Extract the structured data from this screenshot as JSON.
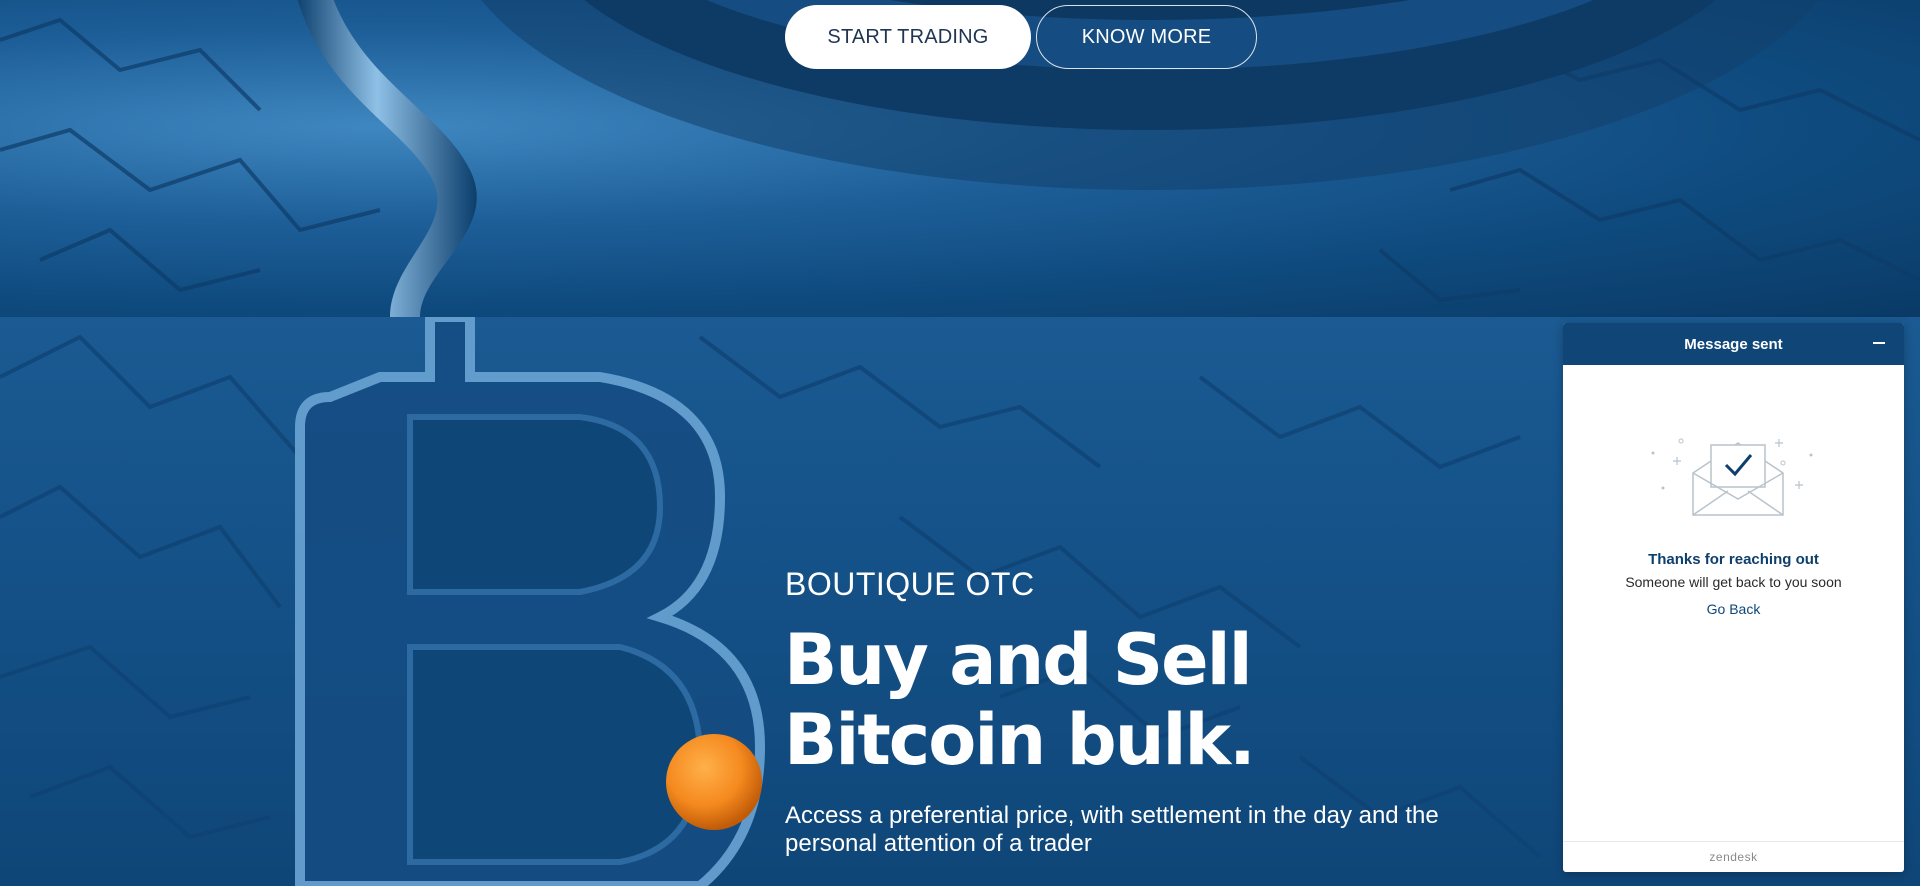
{
  "hero": {
    "start_trading": "START TRADING",
    "know_more": "KNOW MORE"
  },
  "otc": {
    "eyebrow": "BOUTIQUE OTC",
    "headline_line1": "Buy and Sell",
    "headline_line2": "Bitcoin bulk.",
    "description": "Access a preferential price, with settlement in the day and the personal attention of a trader"
  },
  "chat": {
    "title": "Message sent",
    "thanks": "Thanks for reaching out",
    "message": "Someone will get back to you soon",
    "go_back": "Go Back",
    "footer": "zendesk"
  },
  "colors": {
    "brand_blue": "#0f4677",
    "ball_orange": "#f58a1f"
  }
}
